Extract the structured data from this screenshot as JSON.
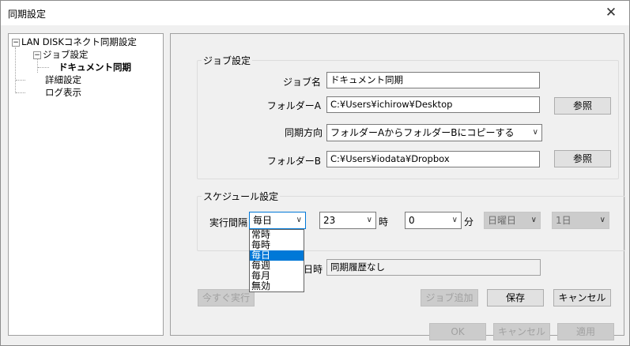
{
  "window": {
    "title": "同期設定",
    "close_glyph": "✕"
  },
  "tree": {
    "root": "LAN DISKコネクト同期設定",
    "job_settings": "ジョブ設定",
    "document_sync": "ドキュメント同期",
    "detail_settings": "詳細設定",
    "log_display": "ログ表示"
  },
  "job": {
    "group_label": "ジョブ設定",
    "name_label": "ジョブ名",
    "name_value": "ドキュメント同期",
    "folder_a_label": "フォルダーA",
    "folder_a_value": "C:¥Users¥ichirow¥Desktop",
    "browse_label": "参照",
    "direction_label": "同期方向",
    "direction_value": "フォルダーAからフォルダーBにコピーする",
    "folder_b_label": "フォルダーB",
    "folder_b_value": "C:¥Users¥iodata¥Dropbox"
  },
  "schedule": {
    "group_label": "スケジュール設定",
    "interval_label": "実行間隔",
    "interval_value": "毎日",
    "hour_value": "23",
    "hour_unit": "時",
    "minute_value": "0",
    "minute_unit": "分",
    "weekday_value": "日曜日",
    "day_value": "1日",
    "interval_options": [
      "常時",
      "毎時",
      "毎日",
      "毎週",
      "毎月",
      "無効"
    ],
    "interval_selected": "毎日",
    "last_sync_label": "日時",
    "last_sync_value": "同期履歴なし"
  },
  "actions": {
    "run_now": "今すぐ実行",
    "add_job": "ジョブ追加",
    "save": "保存",
    "cancel": "キャンセル"
  },
  "footer": {
    "ok": "OK",
    "cancel": "キャンセル",
    "apply": "適用"
  }
}
